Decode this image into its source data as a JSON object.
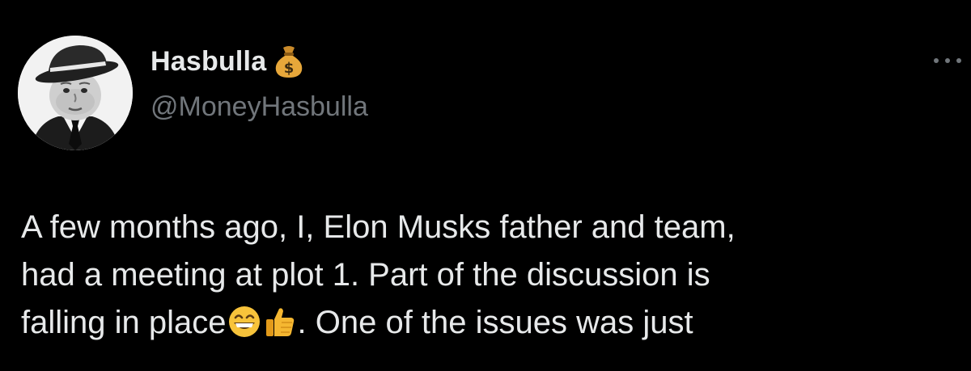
{
  "author": {
    "display_name": "Hasbulla",
    "name_emoji": "money-bag-icon",
    "handle": "@MoneyHasbulla"
  },
  "menu": {
    "icon": "more-horizontal-icon"
  },
  "tweet": {
    "line1": "A few months ago, I, Elon Musks father and team,",
    "line2": "had a meeting at plot 1. Part of the discussion is",
    "line3_start": "falling in place",
    "line3_emojis": [
      "grinning-face-icon",
      "thumbs-up-icon"
    ],
    "line3_end": ". One of the issues was just"
  },
  "colors": {
    "background": "#000000",
    "primary_text": "#e7e9ea",
    "secondary_text": "#71767b"
  }
}
